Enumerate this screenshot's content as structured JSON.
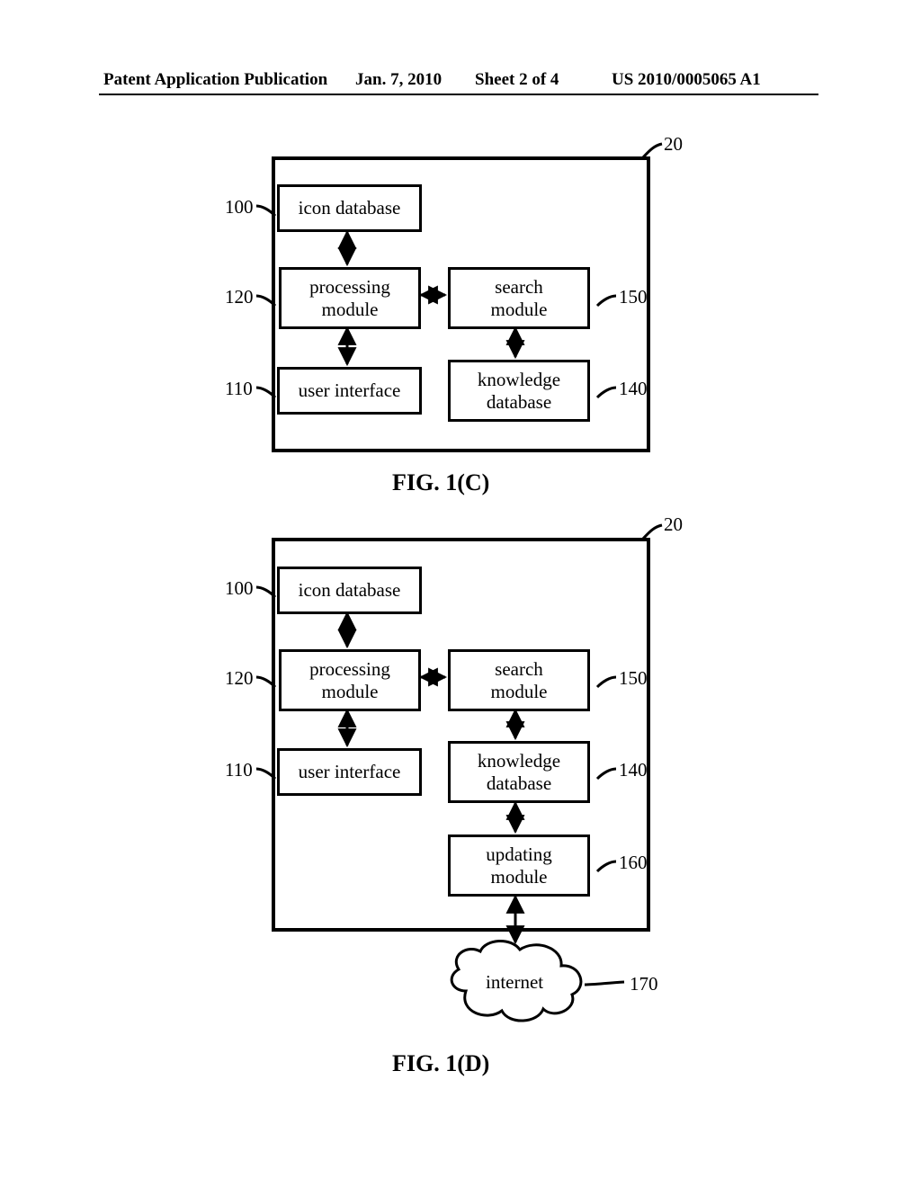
{
  "header": {
    "publication": "Patent Application Publication",
    "date": "Jan. 7, 2010",
    "sheet": "Sheet 2 of 4",
    "docnum": "US 2010/0005065 A1"
  },
  "figC": {
    "caption": "FIG. 1(C)",
    "containerRef": "20",
    "boxes": {
      "iconDb": {
        "label": "icon database",
        "ref": "100"
      },
      "proc": {
        "label": "processing\nmodule",
        "ref": "120"
      },
      "search": {
        "label": "search\nmodule",
        "ref": "150"
      },
      "ui": {
        "label": "user interface",
        "ref": "110"
      },
      "kdb": {
        "label": "knowledge\ndatabase",
        "ref": "140"
      }
    }
  },
  "figD": {
    "caption": "FIG. 1(D)",
    "containerRef": "20",
    "boxes": {
      "iconDb": {
        "label": "icon database",
        "ref": "100"
      },
      "proc": {
        "label": "processing\nmodule",
        "ref": "120"
      },
      "search": {
        "label": "search\nmodule",
        "ref": "150"
      },
      "ui": {
        "label": "user interface",
        "ref": "110"
      },
      "kdb": {
        "label": "knowledge\ndatabase",
        "ref": "140"
      },
      "upd": {
        "label": "updating\nmodule",
        "ref": "160"
      },
      "internet": {
        "label": "internet",
        "ref": "170"
      }
    }
  }
}
